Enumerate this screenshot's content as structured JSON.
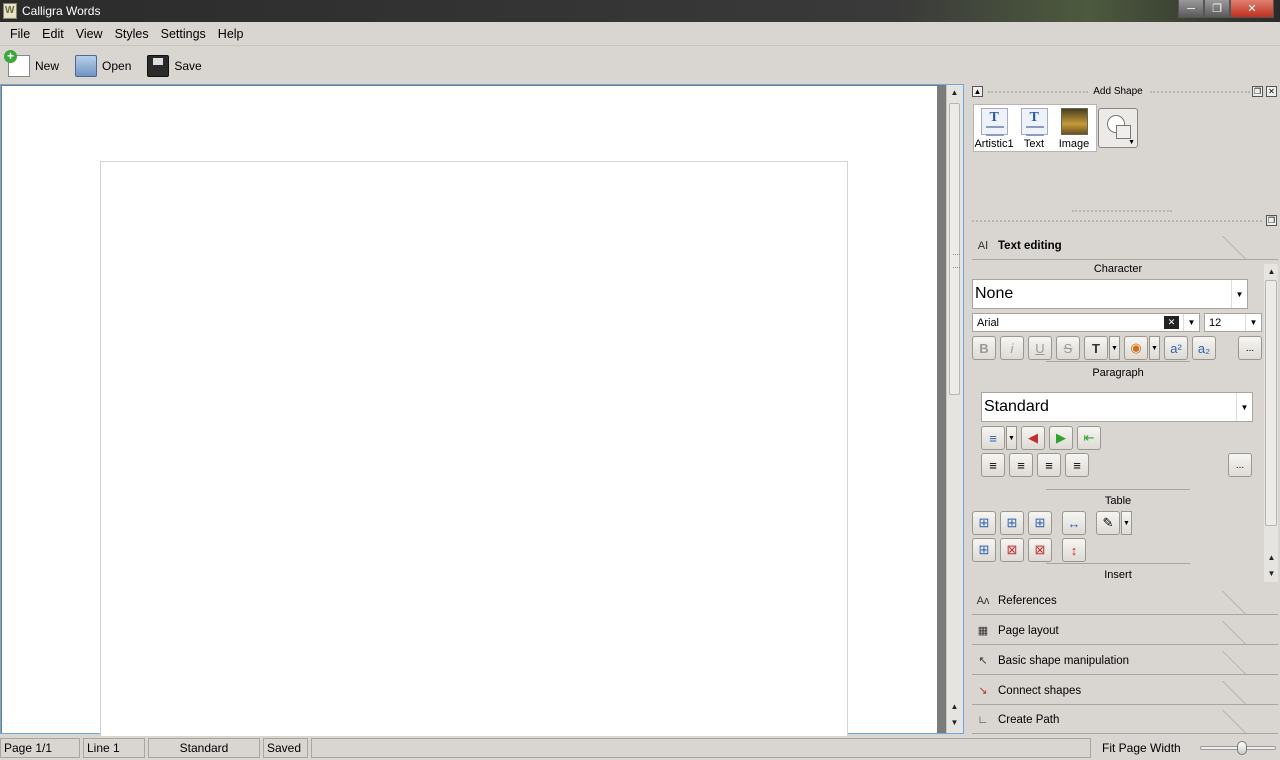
{
  "window": {
    "title": "Calligra Words"
  },
  "menu": [
    "File",
    "Edit",
    "View",
    "Styles",
    "Settings",
    "Help"
  ],
  "toolbar": {
    "new_label": "New",
    "open_label": "Open",
    "save_label": "Save"
  },
  "add_shape": {
    "title": "Add Shape",
    "items": [
      "Artistic1",
      "Text",
      "Image"
    ]
  },
  "text_editing": {
    "tab_label": "Text editing",
    "character_title": "Character",
    "character_style": "None",
    "font": "Arial",
    "font_size": "12",
    "paragraph_title": "Paragraph",
    "paragraph_style": "Standard",
    "table_title": "Table",
    "insert_title": "Insert",
    "more_label": "..."
  },
  "dock_sections": [
    {
      "label": "References",
      "icon": "references-icon"
    },
    {
      "label": "Page layout",
      "icon": "page-layout-icon"
    },
    {
      "label": "Basic shape manipulation",
      "icon": "pointer-icon"
    },
    {
      "label": "Connect shapes",
      "icon": "connect-shapes-icon"
    },
    {
      "label": "Create Path",
      "icon": "path-icon"
    }
  ],
  "status": {
    "page": "Page 1/1",
    "line": "Line 1",
    "style": "Standard",
    "saved": "Saved",
    "zoom": "Fit Page Width"
  },
  "zoom_slider_fraction": 0.57
}
